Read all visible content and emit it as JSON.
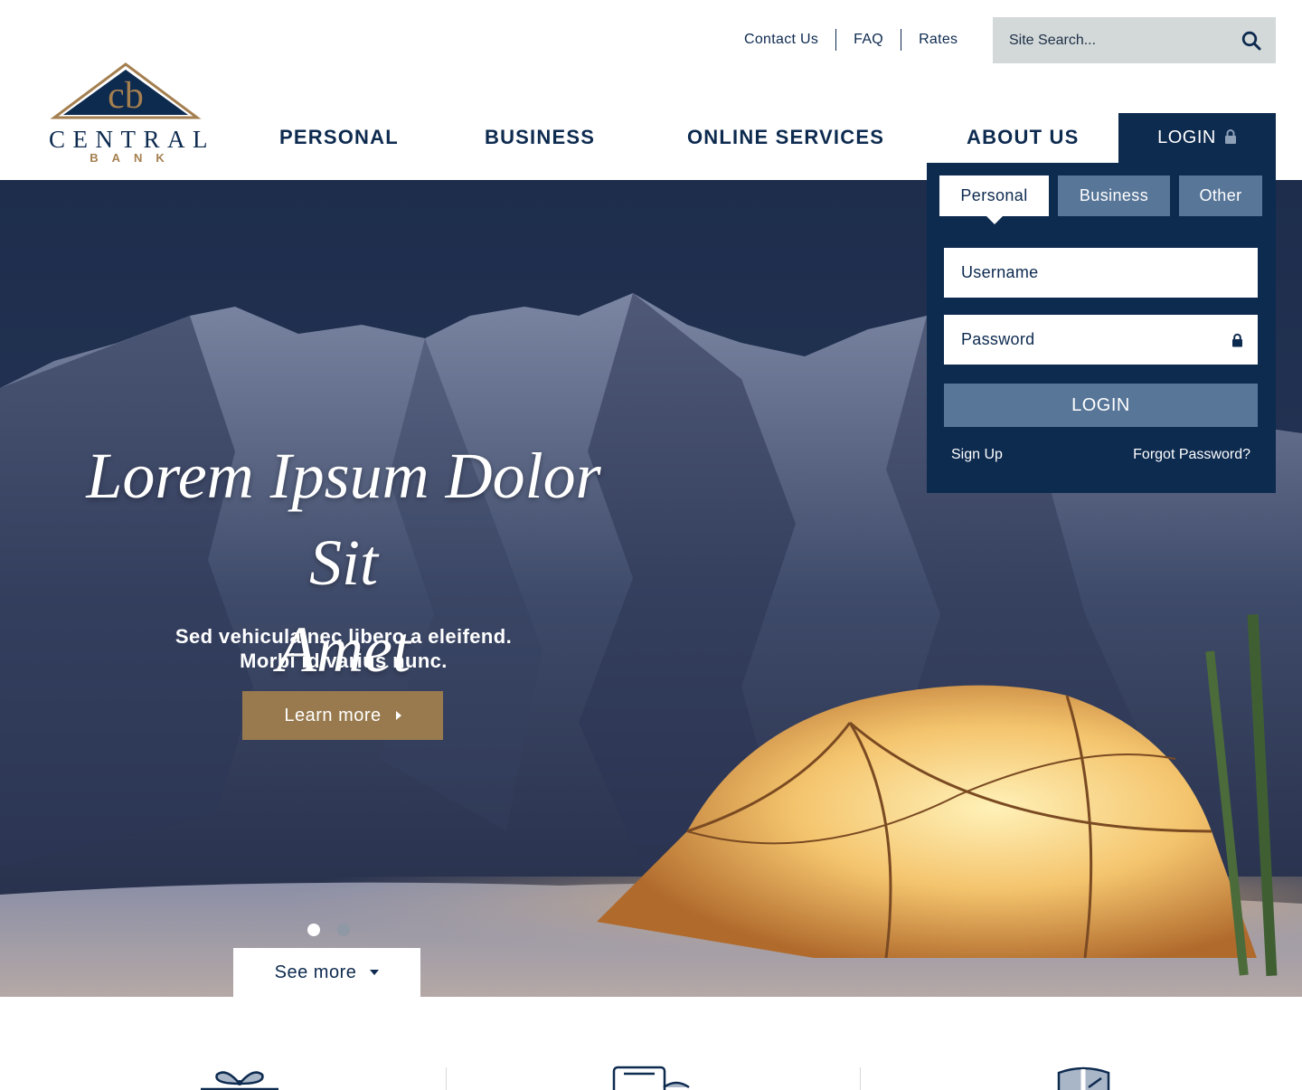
{
  "brand": {
    "name": "CENTRAL",
    "sub": "BANK",
    "monogram": "cb",
    "colors": {
      "navy": "#0d2a4f",
      "gold": "#a47f4f",
      "steel": "#587698",
      "search_bg": "#d3d8d9"
    }
  },
  "utility_nav": {
    "contact": "Contact Us",
    "faq": "FAQ",
    "rates": "Rates"
  },
  "search": {
    "placeholder": "Site Search...",
    "icon": "search-icon"
  },
  "main_nav": {
    "personal": "PERSONAL",
    "business": "BUSINESS",
    "online_services": "ONLINE SERVICES",
    "about_us": "ABOUT US",
    "login": "LOGIN",
    "login_icon": "lock-icon"
  },
  "hero": {
    "title_line1": "Lorem Ipsum Dolor Sit",
    "title_line2": "Amet",
    "subtitle_line1": "Sed vehicula nec libero a eleifend.",
    "subtitle_line2": "Morbi id varius nunc.",
    "cta_label": "Learn more",
    "carousel": {
      "total": 2,
      "active": 1
    },
    "see_more_label": "See more"
  },
  "login_panel": {
    "tabs": [
      {
        "label": "Personal",
        "active": true
      },
      {
        "label": "Business",
        "active": false
      },
      {
        "label": "Other",
        "active": false
      }
    ],
    "username_placeholder": "Username",
    "password_placeholder": "Password",
    "submit_label": "LOGIN",
    "signup_label": "Sign Up",
    "forgot_label": "Forgot Password?"
  },
  "features": {
    "icons": [
      "gift-icon",
      "devices-icon",
      "shield-icon"
    ]
  }
}
